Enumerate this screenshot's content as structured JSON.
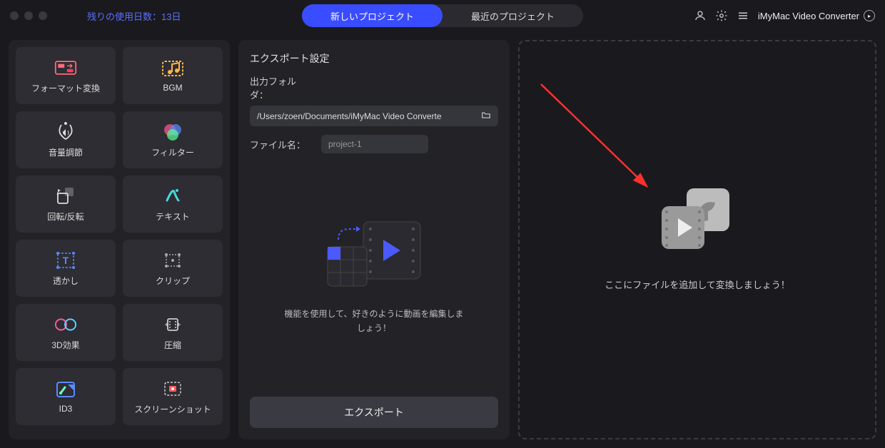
{
  "topbar": {
    "trial_label": "残りの使用日数：13日",
    "tab_new": "新しいプロジェクト",
    "tab_recent": "最近のプロジェクト",
    "brand": "iMyMac Video Converter"
  },
  "tools": [
    {
      "id": "format-convert",
      "label": "フォーマット変換"
    },
    {
      "id": "bgm",
      "label": "BGM"
    },
    {
      "id": "volume",
      "label": "音量調節"
    },
    {
      "id": "filter",
      "label": "フィルター"
    },
    {
      "id": "rotate",
      "label": "回転/反転"
    },
    {
      "id": "text",
      "label": "テキスト"
    },
    {
      "id": "watermark",
      "label": "透かし"
    },
    {
      "id": "clip",
      "label": "クリップ"
    },
    {
      "id": "3d",
      "label": "3D効果"
    },
    {
      "id": "compress",
      "label": "圧縮"
    },
    {
      "id": "id3",
      "label": "ID3"
    },
    {
      "id": "screenshot",
      "label": "スクリーンショット"
    }
  ],
  "export": {
    "title": "エクスポート設定",
    "folder_label": "出力フォルダ：",
    "folder_path": "/Users/zoen/Documents/iMyMac Video Converte",
    "filename_label": "ファイル名：",
    "filename_value": "project-1",
    "hint": "機能を使用して、好きのように動画を編集しましょう！",
    "button": "エクスポート"
  },
  "dropzone": {
    "text": "ここにファイルを追加して変換しましょう！"
  }
}
